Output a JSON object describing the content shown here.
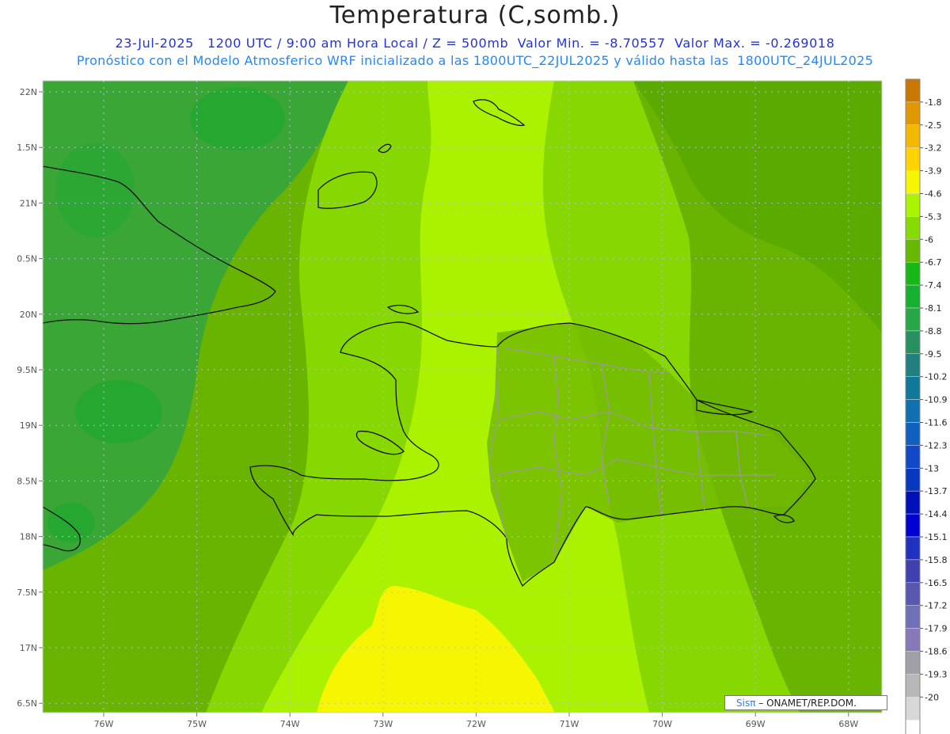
{
  "header": {
    "title": "Temperatura (C,somb.)",
    "line1": "23-Jul-2025   1200 UTC / 9:00 am Hora Local / Z = 500mb  Valor Min. = -8.70557  Valor Max. = -0.269018",
    "line2": "Pronóstico con el Modelo Atmosferico WRF inicializado a las 1800UTC_22JUL2025 y válido hasta las  1800UTC_24JUL2025"
  },
  "axes": {
    "lat_labels": [
      "22N",
      "1.5N",
      "21N",
      "0.5N",
      "20N",
      "9.5N",
      "19N",
      "8.5N",
      "18N",
      "7.5N",
      "17N",
      "6.5N"
    ],
    "lon_labels": [
      "76W",
      "75W",
      "74W",
      "73W",
      "72W",
      "71W",
      "70W",
      "69W",
      "68W"
    ]
  },
  "colorbar": {
    "labels": [
      "-1.8",
      "-2.5",
      "-3.2",
      "-3.9",
      "-4.6",
      "-5.3",
      "-6",
      "-6.7",
      "-7.4",
      "-8.1",
      "-8.8",
      "-9.5",
      "-10.2",
      "-10.9",
      "-11.6",
      "-12.3",
      "-13",
      "-13.7",
      "-14.4",
      "-15.1",
      "-15.8",
      "-16.5",
      "-17.2",
      "-17.9",
      "-18.6",
      "-19.3",
      "-20"
    ],
    "colors": [
      "#c87800",
      "#e09800",
      "#f2b800",
      "#ffd200",
      "#f6f600",
      "#aaf400",
      "#86dc00",
      "#66b800",
      "#16b816",
      "#16b030",
      "#26a848",
      "#289060",
      "#208080",
      "#107898",
      "#1070b0",
      "#1060c0",
      "#1048c8",
      "#0838c0",
      "#0010b8",
      "#0000d0",
      "#2030c0",
      "#4040b0",
      "#5858b0",
      "#7070b8",
      "#8878b8",
      "#a0a0a8",
      "#b8b8b8",
      "#d8d8d8",
      "#ffffff"
    ]
  },
  "map_colors": {
    "ocean_dark": "#3aa636",
    "mid_green": "#68b400",
    "lime": "#86d800",
    "bright_lime": "#aaf200",
    "yellow": "#f6f600"
  },
  "credit": {
    "logo": "Sisπ",
    "text": "– ONAMET/REP.DOM."
  }
}
